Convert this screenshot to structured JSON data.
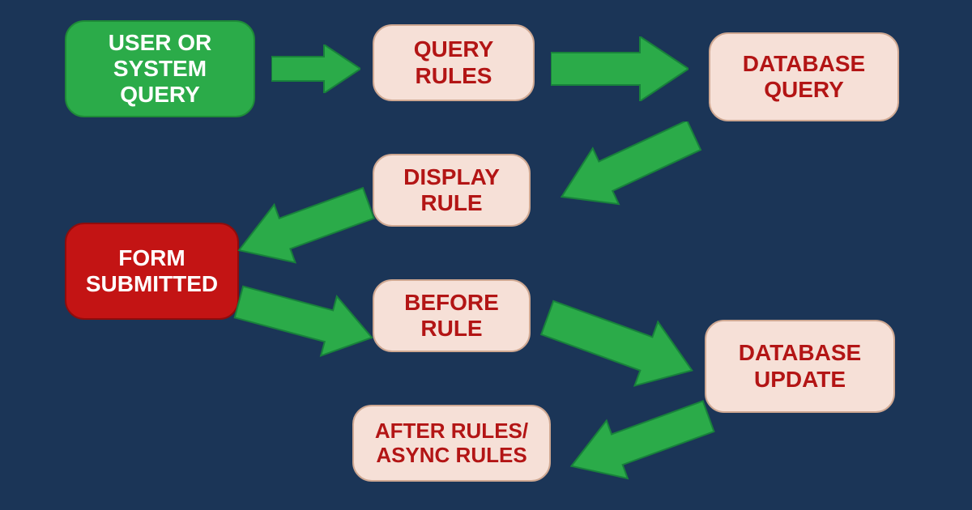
{
  "nodes": {
    "user_query": "USER OR SYSTEM QUERY",
    "query_rules": "QUERY RULES",
    "database_query": "DATABASE QUERY",
    "display_rule": "DISPLAY RULE",
    "form_submitted": "FORM SUBMITTED",
    "before_rule": "BEFORE RULE",
    "database_update": "DATABASE UPDATE",
    "after_rules": "AFTER RULES/ ASYNC RULES"
  },
  "colors": {
    "bg": "#1b3557",
    "arrow_fill": "#2bab49",
    "arrow_stroke": "#18813b",
    "pink_bg": "#f6e0d7",
    "pink_text": "#b31515",
    "red_bg": "#c31414",
    "green_bg": "#2bab49"
  }
}
